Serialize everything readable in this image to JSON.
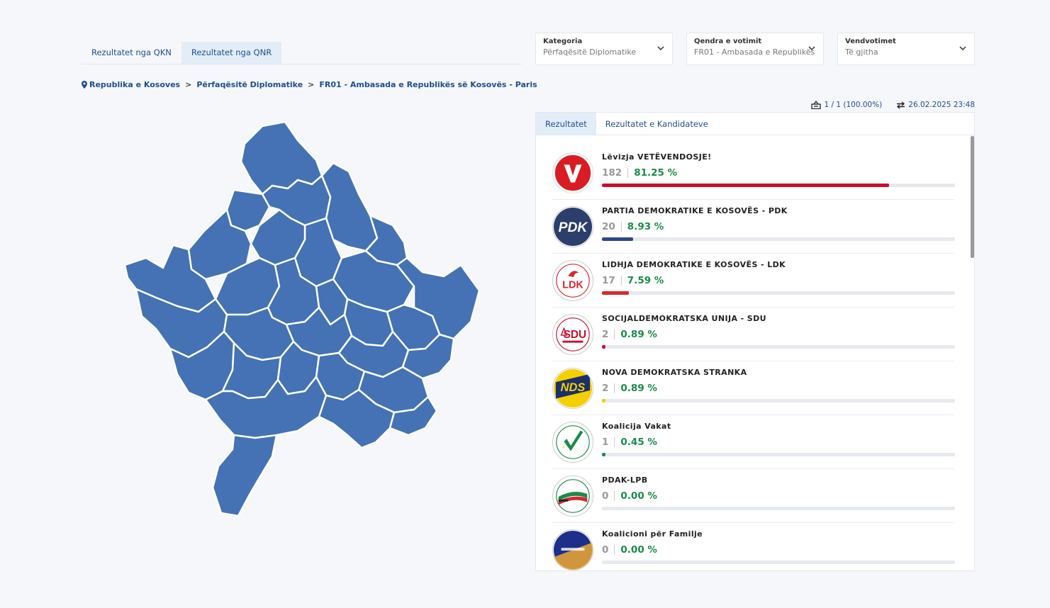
{
  "top_tabs": [
    {
      "label": "Rezultatet nga QKN"
    },
    {
      "label": "Rezultatet nga QNR"
    }
  ],
  "filters": {
    "category": {
      "label": "Kategoria",
      "value": "Përfaqësitë Diplomatike"
    },
    "center": {
      "label": "Qendra e votimit",
      "value": "FR01 - Ambasada e Republikës"
    },
    "station": {
      "label": "Vendvotimet",
      "value": "Të gjitha"
    }
  },
  "breadcrumb": {
    "item1": "Republika e Kosoves",
    "item2": "Përfaqësitë Diplomatike",
    "item3": "FR01 - Ambasada e Republikës së Kosovës - Paris",
    "separator": ">"
  },
  "status": {
    "stations": "1 / 1 (100.00%)",
    "updated": "26.02.2025 23:48"
  },
  "panel_tabs": [
    {
      "label": "Rezultatet"
    },
    {
      "label": "Rezultatet e Kandidateve"
    }
  ],
  "parties": [
    {
      "name": "Lëvizja VETËVENDOSJE!",
      "votes": "182",
      "percent": "81.25 %",
      "share": 81.25,
      "color": "#c8102e",
      "logo_icon": "vv-logo-icon"
    },
    {
      "name": "PARTIA DEMOKRATIKE E KOSOVËS - PDK",
      "votes": "20",
      "percent": "8.93 %",
      "share": 8.93,
      "color": "#2c4a84",
      "logo_icon": "pdk-logo-icon",
      "logo_text": "PDK"
    },
    {
      "name": "LIDHJA DEMOKRATIKE E KOSOVËS - LDK",
      "votes": "17",
      "percent": "7.59 %",
      "share": 7.59,
      "color": "#d9272e",
      "logo_icon": "ldk-logo-icon",
      "logo_text": "LDK"
    },
    {
      "name": "SOCIJALDEMOKRATSKA UNIJA - SDU",
      "votes": "2",
      "percent": "0.89 %",
      "share": 0.89,
      "color": "#c8102e",
      "logo_icon": "sdu-logo-icon",
      "logo_text": "SDU"
    },
    {
      "name": "NOVA DEMOKRATSKA STRANKA",
      "votes": "2",
      "percent": "0.89 %",
      "share": 0.89,
      "color": "#f0d000",
      "logo_icon": "nds-logo-icon",
      "logo_text": "NDS"
    },
    {
      "name": "Koalicija Vakat",
      "votes": "1",
      "percent": "0.45 %",
      "share": 0.45,
      "color": "#1b8a4a",
      "logo_icon": "vakat-logo-icon"
    },
    {
      "name": "PDAK-LPB",
      "votes": "0",
      "percent": "0.00 %",
      "share": 0,
      "color": "#1b8a4a",
      "logo_icon": "pdak-logo-icon"
    },
    {
      "name": "Koalicioni për Familje",
      "votes": "0",
      "percent": "0.00 %",
      "share": 0,
      "color": "#2c4a84",
      "logo_icon": "familje-logo-icon"
    }
  ],
  "colors": {
    "accent": "#1f4e8c",
    "map_fill": "#4472b4",
    "percent_green": "#1b8a4a"
  }
}
